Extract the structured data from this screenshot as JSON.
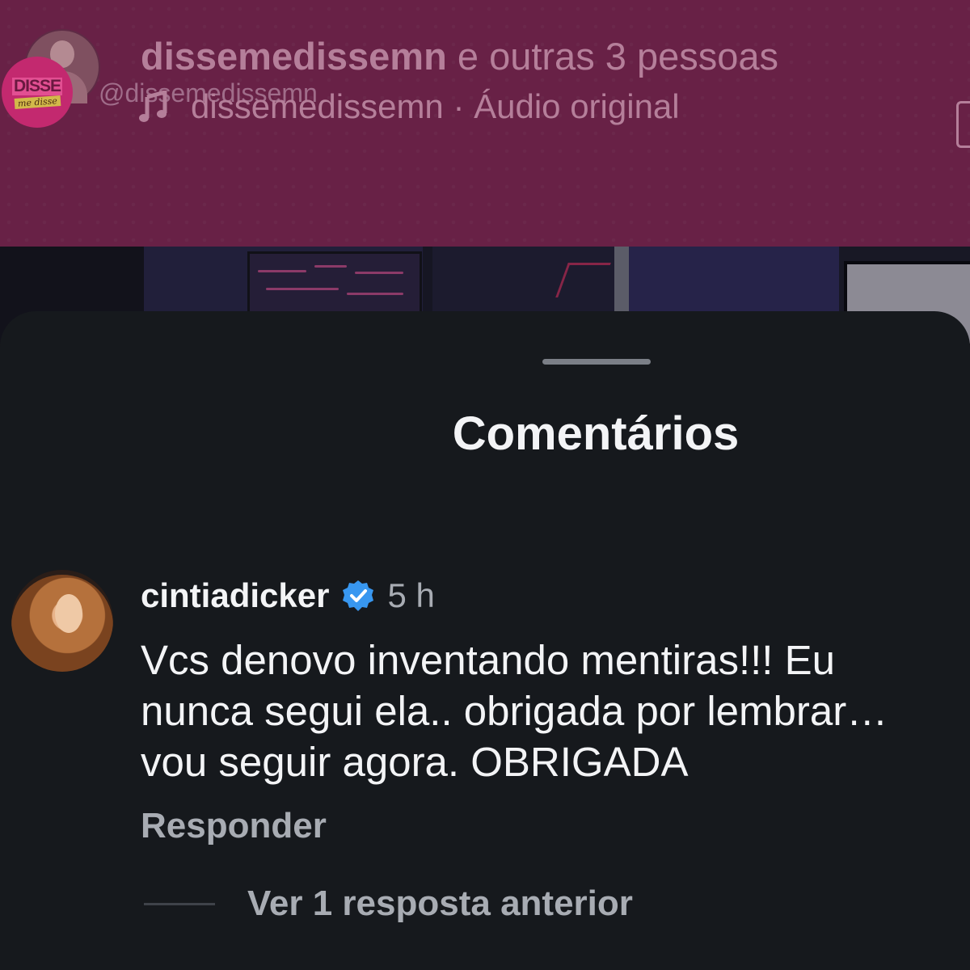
{
  "reel": {
    "title_bold": "dissemedissemn",
    "title_rest": " e outras 3 pessoas",
    "handle_overlay": "@dissemedissemn",
    "audio_text": "dissemedissemn · Áudio original",
    "logo_line1": "DISSE",
    "logo_line2": "me disse",
    "music_icon": "music-note-icon"
  },
  "comments_sheet": {
    "title": "Comentários",
    "comment": {
      "username": "cintiadicker",
      "verified_icon": "verified-badge-icon",
      "time": "5 h",
      "text_lines": [
        "Vcs denovo inventando mentiras!!! Eu",
        "nunca segui ela.. obrigada por lembrar…",
        "vou seguir agora. OBRIGADA"
      ],
      "reply_label": "Responder",
      "view_replies_label": "Ver 1 resposta anterior"
    }
  },
  "colors": {
    "sheet_bg": "#16191d",
    "reel_bg": "#8a2f5c",
    "verified": "#3897f0",
    "secondary_text": "#a8acb3"
  }
}
